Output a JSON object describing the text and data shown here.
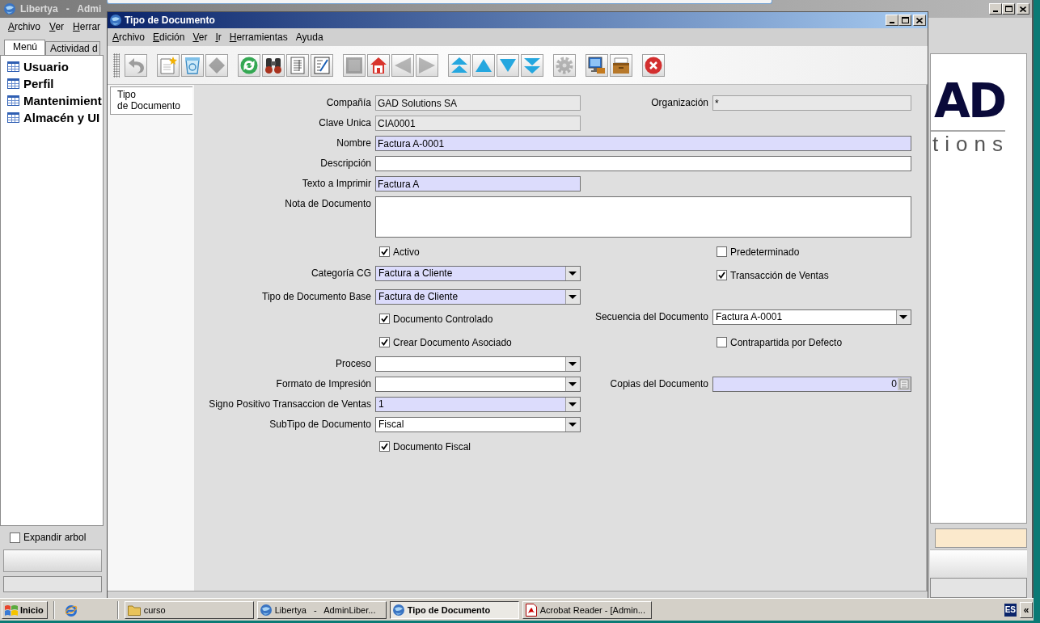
{
  "background_window": {
    "title": "Libertya   -   Admi",
    "menu": [
      {
        "label": "Archivo",
        "mnemonic": true
      },
      {
        "label": "Ver",
        "mnemonic": true
      },
      {
        "label": "Herrar",
        "mnemonic": true
      }
    ],
    "tabs": [
      {
        "label": "Menú",
        "selected": true
      },
      {
        "label": "Actividad d",
        "selected": false
      }
    ],
    "tree": [
      {
        "label": "Usuario"
      },
      {
        "label": "Perfil"
      },
      {
        "label": "Mantenimient"
      },
      {
        "label": "Almacén y UI"
      }
    ],
    "expand_tree": {
      "label": "Expandir arbol",
      "checked": false
    },
    "logo": {
      "mark": "AD",
      "tagline": "tions"
    }
  },
  "window": {
    "title": "Tipo de Documento",
    "menu": [
      {
        "label": "Archivo",
        "mnemonic": true
      },
      {
        "label": "Edición",
        "mnemonic": true
      },
      {
        "label": "Ver",
        "mnemonic": true
      },
      {
        "label": "Ir",
        "mnemonic": true
      },
      {
        "label": "Herramientas",
        "mnemonic": true
      },
      {
        "label": "Ayuda",
        "mnemonic": false
      }
    ],
    "toolbar": [
      {
        "buttons": [
          {
            "kind": "undo",
            "disabled": true
          }
        ]
      },
      {
        "buttons": [
          {
            "kind": "new",
            "disabled": false
          },
          {
            "kind": "trash",
            "disabled": false
          },
          {
            "kind": "diamond",
            "disabled": true
          }
        ]
      },
      {
        "buttons": [
          {
            "kind": "refresh",
            "disabled": false
          },
          {
            "kind": "binoculars",
            "disabled": false
          },
          {
            "kind": "document",
            "disabled": false
          },
          {
            "kind": "chart",
            "disabled": false
          }
        ]
      },
      {
        "buttons": [
          {
            "kind": "square",
            "disabled": true
          },
          {
            "kind": "house",
            "disabled": false
          },
          {
            "kind": "left",
            "disabled": true
          },
          {
            "kind": "right",
            "disabled": true
          }
        ]
      },
      {
        "buttons": [
          {
            "kind": "first",
            "disabled": false
          },
          {
            "kind": "up",
            "disabled": false
          },
          {
            "kind": "down",
            "disabled": false
          },
          {
            "kind": "last",
            "disabled": false
          }
        ]
      },
      {
        "buttons": [
          {
            "kind": "gear",
            "disabled": true
          }
        ]
      },
      {
        "buttons": [
          {
            "kind": "monitor",
            "disabled": false
          },
          {
            "kind": "box",
            "disabled": false
          }
        ]
      },
      {
        "buttons": [
          {
            "kind": "close",
            "disabled": false
          }
        ]
      }
    ],
    "tabs": [
      {
        "label": "Tipo\nde Documento",
        "selected": true
      }
    ],
    "form": {
      "rows": [
        {
          "left": {
            "kind": "text",
            "label": "Compañía",
            "value": "GAD Solutions SA",
            "readonly": true,
            "mandatory": false
          },
          "right": {
            "kind": "text",
            "label": "Organización",
            "value": "*",
            "readonly": true,
            "mandatory": false
          }
        },
        {
          "left": {
            "kind": "text",
            "label": "Clave Unica",
            "value": "CIA0001",
            "readonly": true,
            "mandatory": false
          }
        },
        {
          "full": {
            "kind": "text",
            "label": "Nombre",
            "value": "Factura A-0001",
            "readonly": false,
            "mandatory": true
          }
        },
        {
          "full": {
            "kind": "text",
            "label": "Descripción",
            "readonly": false,
            "mandatory": false
          }
        },
        {
          "left": {
            "kind": "text",
            "label": "Texto a Imprimir",
            "value": "Factura A",
            "readonly": false,
            "mandatory": true
          }
        },
        {
          "full": {
            "kind": "textarea",
            "label": "Nota de Documento",
            "readonly": false,
            "mandatory": false
          }
        },
        {
          "left": {
            "kind": "checkbox",
            "label": "Activo",
            "checked": true
          },
          "right": {
            "kind": "checkbox",
            "label": "Predeterminado",
            "checked": false
          }
        },
        {
          "left": {
            "kind": "combo",
            "label": "Categoría CG",
            "value": "Factura a Cliente",
            "readonly": false,
            "mandatory": true
          },
          "right": {
            "kind": "checkbox",
            "label": "Transacción de Ventas",
            "checked": true
          }
        },
        {
          "left": {
            "kind": "combo",
            "label": "Tipo de Documento Base",
            "value": "Factura de Cliente",
            "readonly": false,
            "mandatory": true
          }
        },
        {
          "left": {
            "kind": "checkbox",
            "label": "Documento Controlado",
            "checked": true
          },
          "right": {
            "kind": "combo",
            "label": "Secuencia del Documento",
            "value": "Factura A-0001",
            "readonly": false,
            "mandatory": false
          }
        },
        {
          "left": {
            "kind": "checkbox",
            "label": "Crear Documento Asociado",
            "checked": true
          },
          "right": {
            "kind": "checkbox",
            "label": "Contrapartida por Defecto",
            "checked": false
          }
        },
        {
          "left": {
            "kind": "combo",
            "label": "Proceso",
            "readonly": false,
            "mandatory": false
          }
        },
        {
          "left": {
            "kind": "combo",
            "label": "Formato de Impresión",
            "readonly": false,
            "mandatory": false
          },
          "right": {
            "kind": "number",
            "label": "Copias del Documento",
            "value": "0",
            "readonly": false,
            "mandatory": true
          }
        },
        {
          "left": {
            "kind": "combo",
            "label": "Signo Positivo Transaccion de Ventas",
            "value": "1",
            "readonly": false,
            "mandatory": true
          }
        },
        {
          "left": {
            "kind": "combo",
            "label": "SubTipo de Documento",
            "value": "Fiscal",
            "readonly": false,
            "mandatory": false
          }
        },
        {
          "left": {
            "kind": "checkbox",
            "label": "Documento Fiscal",
            "checked": true
          }
        }
      ]
    }
  },
  "taskbar": {
    "start": "Inicio",
    "tasks": [
      {
        "label": "curso",
        "kind": "folder",
        "selected": false
      },
      {
        "label": "Libertya   -   AdminLiber...",
        "kind": "app",
        "selected": false
      },
      {
        "label": "Tipo de Documento",
        "kind": "app",
        "selected": true
      },
      {
        "label": "Acrobat Reader - [Admin...",
        "kind": "reader",
        "selected": false
      }
    ],
    "tray": {
      "language": "ES",
      "expand": "«"
    }
  }
}
